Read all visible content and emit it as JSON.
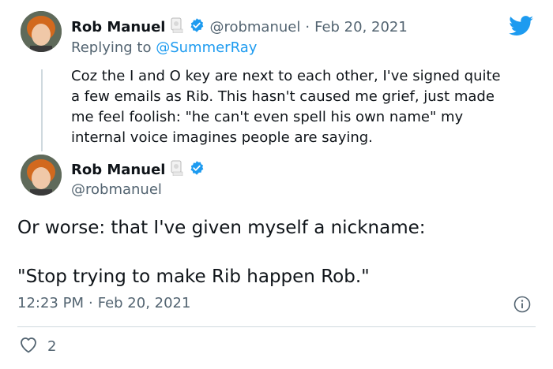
{
  "reply_tweet": {
    "author_name": "Rob Manuel",
    "handle": "@robmanuel",
    "separator": "·",
    "date": "Feb 20, 2021",
    "replying_prefix": "Replying to ",
    "replying_to": "@SummerRay",
    "text_lines": [
      "Coz the I and O key are next to each other, I've signed quite",
      "a few emails as Rib.  This hasn't caused me grief, just made",
      "me feel foolish: \"he can't even spell his own name\" my",
      "internal voice imagines people are saying."
    ]
  },
  "main_tweet": {
    "author_name": "Rob Manuel",
    "handle": "@robmanuel",
    "text_line_1": "Or worse: that I've given myself a nickname:",
    "text_line_2": "\"Stop trying to make Rib happen Rob.\"",
    "time": "12:23 PM",
    "separator": "·",
    "date": "Feb 20, 2021",
    "like_count": "2"
  },
  "icons": {
    "verified": "verified-badge-icon",
    "toilet_paper": "toilet-paper-icon",
    "brand": "twitter-bird-icon",
    "info": "info-icon",
    "like": "heart-icon"
  },
  "colors": {
    "brand_blue": "#1d9bf0",
    "muted_text": "#536471",
    "divider": "#cfd9de"
  }
}
